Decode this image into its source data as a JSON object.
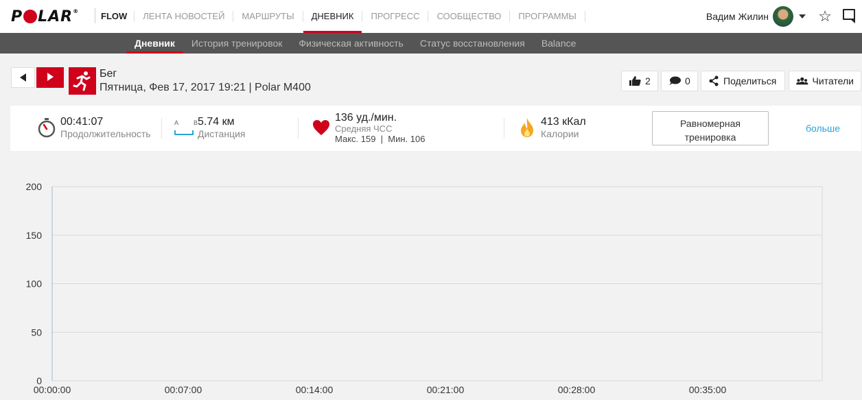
{
  "topnav": {
    "logo": "POLAR",
    "flow": "FLOW",
    "items": [
      "ЛЕНТА НОВОСТЕЙ",
      "МАРШРУТЫ",
      "ДНЕВНИК",
      "ПРОГРЕСС",
      "СООБЩЕСТВО",
      "ПРОГРАММЫ"
    ],
    "active_index": 2,
    "user_name": "Вадим Жилин",
    "icons": [
      "avatar",
      "chevron-down-icon",
      "star-icon",
      "message-icon"
    ]
  },
  "subnav": {
    "items": [
      "Дневник",
      "История тренировок",
      "Физическая активность",
      "Статус восстановления",
      "Balance"
    ],
    "active_index": 0
  },
  "session": {
    "sport": "Бег",
    "date_line": "Пятница, Фев 17, 2017 19:21 | Polar M400",
    "likes": "2",
    "comments": "0",
    "share_label": "Поделиться",
    "followers_label": "Читатели"
  },
  "summary": {
    "duration": {
      "value": "00:41:07",
      "label": "Продолжительность"
    },
    "distance": {
      "value": "5.74 км",
      "label": "Дистанция",
      "ab": "A B"
    },
    "heart_rate": {
      "value": "136 уд./мин.",
      "label": "Средняя ЧСС",
      "minmax": "Макс. 159  |  Мин. 106"
    },
    "calories": {
      "value": "413 кКал",
      "label": "Калории"
    },
    "workout_type": [
      "Равномерная",
      "тренировка"
    ],
    "more_label": "больше"
  },
  "colors": {
    "accent": "#d0011b",
    "link": "#2aa3d8",
    "subnav_bg": "#555555"
  },
  "chart_data": {
    "type": "line",
    "x_ticks": [
      "00:00:00",
      "00:07:00",
      "00:14:00",
      "00:21:00",
      "00:28:00",
      "00:35:00"
    ],
    "y_ticks": [
      0,
      50,
      100,
      150,
      200
    ],
    "ylim": [
      0,
      200
    ],
    "grid": true,
    "series": []
  }
}
